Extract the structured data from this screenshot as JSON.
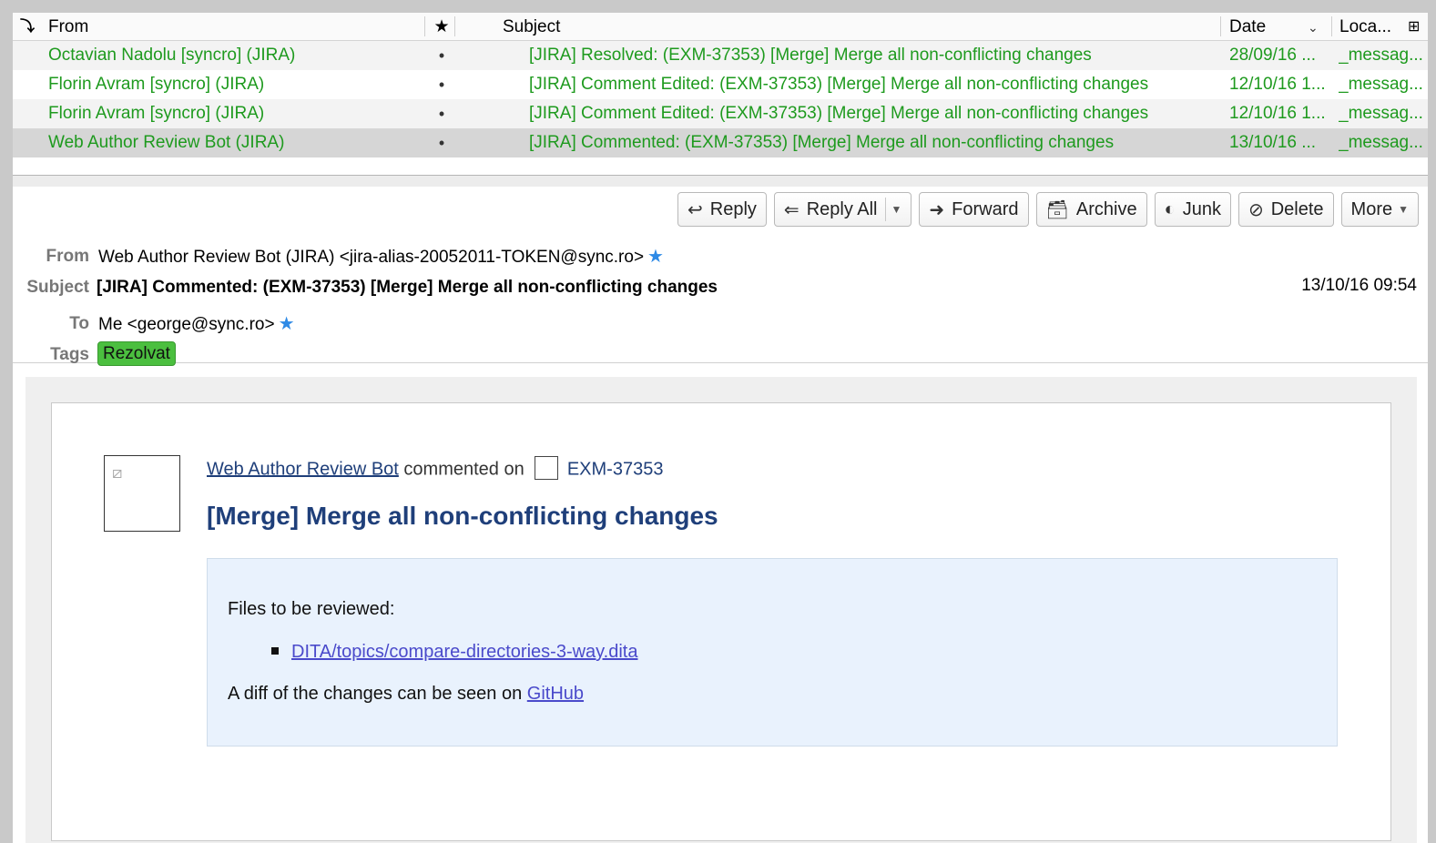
{
  "list": {
    "columns": {
      "from": "From",
      "subject": "Subject",
      "date": "Date",
      "location": "Loca..."
    },
    "rows": [
      {
        "from": "Octavian Nadolu [syncro] (JIRA)",
        "subject": "[JIRA] Resolved: (EXM-37353) [Merge] Merge all non-conflicting changes",
        "date": "28/09/16 ...",
        "location": "_messag..."
      },
      {
        "from": "Florin Avram [syncro] (JIRA)",
        "subject": "[JIRA] Comment Edited: (EXM-37353) [Merge] Merge all non-conflicting changes",
        "date": "12/10/16 1...",
        "location": "_messag..."
      },
      {
        "from": "Florin Avram [syncro] (JIRA)",
        "subject": "[JIRA] Comment Edited: (EXM-37353) [Merge] Merge all non-conflicting changes",
        "date": "12/10/16 1...",
        "location": "_messag..."
      },
      {
        "from": "Web Author Review Bot (JIRA)",
        "subject": "[JIRA] Commented: (EXM-37353) [Merge] Merge all non-conflicting changes",
        "date": "13/10/16 ...",
        "location": "_messag..."
      }
    ],
    "text_color": "#1e9a1e"
  },
  "toolbar": {
    "reply": "Reply",
    "reply_all": "Reply All",
    "forward": "Forward",
    "archive": "Archive",
    "junk": "Junk",
    "delete": "Delete",
    "more": "More"
  },
  "header": {
    "from_label": "From",
    "from_value": "Web Author Review Bot (JIRA) <jira-alias-20052011-TOKEN@sync.ro>",
    "subject_label": "Subject",
    "subject_value": "[JIRA] Commented: (EXM-37353) [Merge] Merge all non-conflicting changes",
    "date_value": "13/10/16 09:54",
    "to_label": "To",
    "to_value": "Me <george@sync.ro>",
    "tags_label": "Tags",
    "tag": "Rezolvat",
    "tag_color": "#4bbf3f"
  },
  "body": {
    "author_link": "Web Author Review Bot",
    "commented_on": "commented on",
    "issue_key": "EXM-37353",
    "issue_title": "[Merge] Merge all non-conflicting changes",
    "files_heading": "Files to be reviewed:",
    "file_link": "DITA/topics/compare-directories-3-way.dita",
    "diff_text": "A diff of the changes can be seen on",
    "diff_link": "GitHub",
    "title_color": "#1f3f7a",
    "comment_bg": "#e9f2fd"
  }
}
